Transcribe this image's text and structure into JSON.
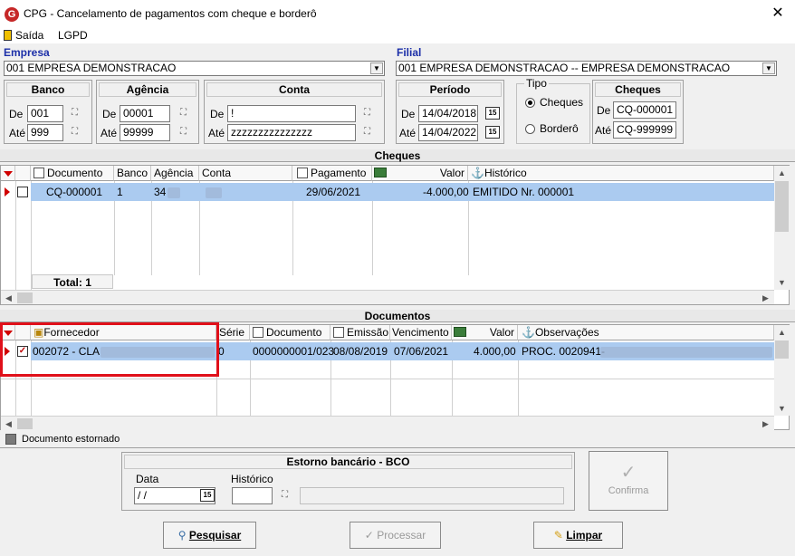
{
  "window": {
    "title": "CPG - Cancelamento de pagamentos com cheque e borderô",
    "icon": "G",
    "close": "✕"
  },
  "menu": {
    "exit_label": "Saída",
    "lgpd_label": "LGPD"
  },
  "empresa": {
    "label": "Empresa",
    "value": "001 EMPRESA DEMONSTRACAO"
  },
  "filial": {
    "label": "Filial",
    "value": "001 EMPRESA DEMONSTRACAO -- EMPRESA DEMONSTRACAO"
  },
  "banco": {
    "title": "Banco",
    "de_label": "De",
    "ate_label": "Até",
    "de": "001",
    "ate": "999"
  },
  "agencia": {
    "title": "Agência",
    "de_label": "De",
    "ate_label": "Até",
    "de": "00001",
    "ate": "99999"
  },
  "conta": {
    "title": "Conta",
    "de_label": "De",
    "ate_label": "Até",
    "de": "!",
    "ate": "zzzzzzzzzzzzzzz"
  },
  "periodo": {
    "title": "Período",
    "de_label": "De",
    "ate_label": "Até",
    "de": "14/04/2018",
    "ate": "14/04/2022",
    "cal": "15"
  },
  "tipo": {
    "title": "Tipo",
    "opt1": "Cheques",
    "opt2": "Borderô",
    "selected": "Cheques"
  },
  "cheques_filter": {
    "title": "Cheques",
    "de_label": "De",
    "ate_label": "Até",
    "de": "CQ-000001",
    "ate": "CQ-999999"
  },
  "cheques_section": {
    "title": "Cheques"
  },
  "cheques_grid": {
    "columns": {
      "documento": "Documento",
      "banco": "Banco",
      "agencia": "Agência",
      "conta": "Conta",
      "pagamento": "Pagamento",
      "valor": "Valor",
      "historico": "Histórico"
    },
    "row": {
      "documento": "CQ-000001",
      "banco": "1",
      "agencia": "34",
      "conta": "",
      "pagamento": "29/06/2021",
      "valor": "-4.000,00",
      "historico": "EMITIDO Nr. 000001"
    },
    "total": "Total: 1"
  },
  "documentos_section": {
    "title": "Documentos"
  },
  "documentos_grid": {
    "columns": {
      "fornecedor": "Fornecedor",
      "serie": "Série",
      "documento": "Documento",
      "emissao": "Emissão",
      "vencimento": "Vencimento",
      "valor": "Valor",
      "observacoes": "Observações"
    },
    "row": {
      "fornecedor": "002072 - CLA",
      "serie": "0",
      "documento": "0000000001/023",
      "emissao": "08/08/2019",
      "vencimento": "07/06/2021",
      "valor": "4.000,00",
      "observacoes": "PROC. 0020941-"
    },
    "highlight_color": "#e0101a"
  },
  "legend": {
    "label": "Documento estornado"
  },
  "estorno": {
    "title": "Estorno bancário - BCO",
    "data_label": "Data",
    "data_value": " / /",
    "historico_label": "Histórico",
    "cal": "15"
  },
  "buttons": {
    "confirma": "Confirma",
    "pesquisar": "Pesquisar",
    "processar": "Processar",
    "limpar": "Limpar"
  },
  "colors": {
    "selection": "#abcbf0",
    "label_blue": "#1c2fa8",
    "marker_red": "#d00000"
  }
}
